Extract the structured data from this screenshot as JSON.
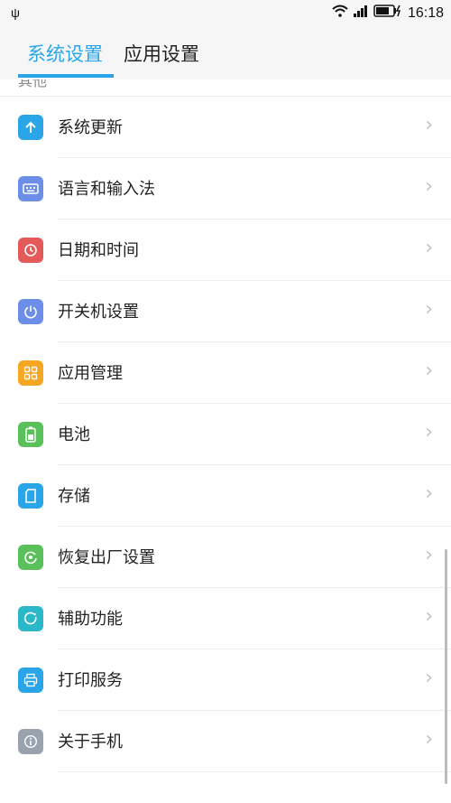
{
  "status_bar": {
    "usb_icon": "usb-icon",
    "wifi_icon": "wifi-icon",
    "signal_icon": "signal-icon",
    "battery_icon": "battery-charging-icon",
    "time": "16:18"
  },
  "tabs": [
    {
      "label": "系统设置",
      "active": true
    },
    {
      "label": "应用设置",
      "active": false
    }
  ],
  "section_peek": "其他",
  "items": [
    {
      "label": "系统更新",
      "icon": "arrow-up-icon",
      "color": "#2aa5e8"
    },
    {
      "label": "语言和输入法",
      "icon": "keyboard-icon",
      "color": "#6c8ee8"
    },
    {
      "label": "日期和时间",
      "icon": "clock-icon",
      "color": "#e45a5a"
    },
    {
      "label": "开关机设置",
      "icon": "power-icon",
      "color": "#6c8ee8"
    },
    {
      "label": "应用管理",
      "icon": "apps-grid-icon",
      "color": "#f5a623"
    },
    {
      "label": "电池",
      "icon": "battery-icon",
      "color": "#5ac05a"
    },
    {
      "label": "存储",
      "icon": "sd-card-icon",
      "color": "#2aa5e8"
    },
    {
      "label": "恢复出厂设置",
      "icon": "restore-icon",
      "color": "#5ac05a"
    },
    {
      "label": "辅助功能",
      "icon": "accessibility-icon",
      "color": "#2ab8c8"
    },
    {
      "label": "打印服务",
      "icon": "printer-icon",
      "color": "#2aa5e8"
    },
    {
      "label": "关于手机",
      "icon": "info-icon",
      "color": "#9aa3ad"
    }
  ]
}
